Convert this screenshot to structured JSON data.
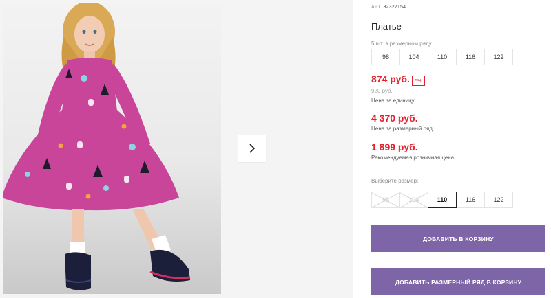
{
  "product": {
    "article_label": "АРТ.",
    "article_number": "32322154",
    "title": "Платье"
  },
  "size_row": {
    "hint": "5 шт. в размерном ряду",
    "sizes": [
      "98",
      "104",
      "110",
      "116",
      "122"
    ]
  },
  "prices": {
    "unit_price": "874 руб.",
    "discount_badge": "5%",
    "old_price": "920 руб.",
    "unit_label": "Цена за единицу",
    "row_price": "4 370 руб.",
    "row_label": "Цена за размерный ряд",
    "rrp_price": "1 899 руб.",
    "rrp_label": "Рекомендуемая розничная цена"
  },
  "size_picker": {
    "label": "Выберите размер:",
    "options": [
      {
        "label": "98",
        "state": "disabled"
      },
      {
        "label": "104",
        "state": "disabled"
      },
      {
        "label": "110",
        "state": "selected"
      },
      {
        "label": "116",
        "state": "available"
      },
      {
        "label": "122",
        "state": "available"
      }
    ]
  },
  "actions": {
    "add_to_cart": "ДОБАВИТЬ В КОРЗИНУ",
    "add_row_to_cart": "ДОБАВИТЬ РАЗМЕРНЫЙ РЯД В КОРЗИНУ"
  },
  "gallery": {
    "next_icon": "chevron-right-icon"
  },
  "colors": {
    "accent_button": "#7e65a8",
    "price_red": "#e4202a",
    "dress_pink": "#c8459a"
  }
}
